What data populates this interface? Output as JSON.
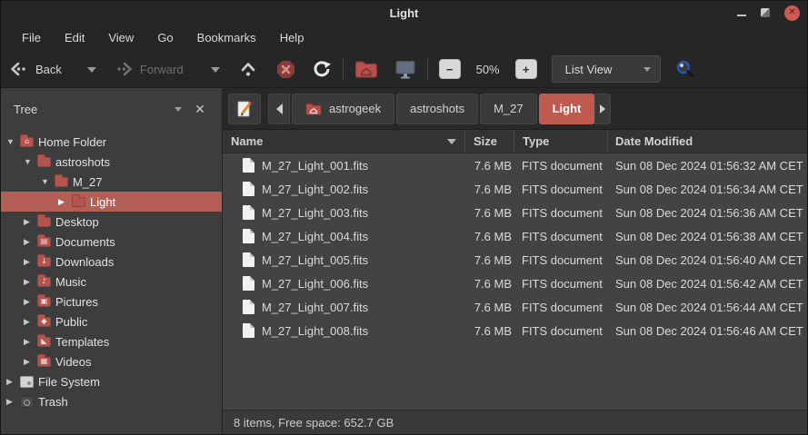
{
  "window": {
    "title": "Light"
  },
  "menubar": {
    "items": [
      "File",
      "Edit",
      "View",
      "Go",
      "Bookmarks",
      "Help"
    ]
  },
  "toolbar": {
    "back_label": "Back",
    "forward_label": "Forward",
    "zoom_level": "50%",
    "view_mode": "List View"
  },
  "sidebar": {
    "header_title": "Tree",
    "items": [
      {
        "label": "Home Folder",
        "icon": "home-folder-icon",
        "glyph": "⌂"
      },
      {
        "label": "astroshots",
        "icon": "folder-icon",
        "glyph": ""
      },
      {
        "label": "M_27",
        "icon": "folder-icon",
        "glyph": ""
      },
      {
        "label": "Light",
        "icon": "folder-icon",
        "glyph": ""
      },
      {
        "label": "Desktop",
        "icon": "desktop-folder-icon",
        "glyph": ""
      },
      {
        "label": "Documents",
        "icon": "documents-folder-icon",
        "glyph": "▤"
      },
      {
        "label": "Downloads",
        "icon": "downloads-folder-icon",
        "glyph": "↓"
      },
      {
        "label": "Music",
        "icon": "music-folder-icon",
        "glyph": "♪"
      },
      {
        "label": "Pictures",
        "icon": "pictures-folder-icon",
        "glyph": "▣"
      },
      {
        "label": "Public",
        "icon": "public-folder-icon",
        "glyph": "◆"
      },
      {
        "label": "Templates",
        "icon": "templates-folder-icon",
        "glyph": "◣"
      },
      {
        "label": "Videos",
        "icon": "videos-folder-icon",
        "glyph": "▦"
      },
      {
        "label": "File System",
        "icon": "drive-icon",
        "glyph": ""
      },
      {
        "label": "Trash",
        "icon": "trash-icon",
        "glyph": ""
      }
    ]
  },
  "pathbar": {
    "crumbs": [
      {
        "label": "astrogeek"
      },
      {
        "label": "astroshots"
      },
      {
        "label": "M_27"
      },
      {
        "label": "Light"
      }
    ]
  },
  "filelist": {
    "columns": {
      "name": "Name",
      "size": "Size",
      "type": "Type",
      "modified": "Date Modified"
    },
    "rows": [
      {
        "name": "M_27_Light_001.fits",
        "size": "7.6 MB",
        "type": "FITS document",
        "modified": "Sun 08 Dec 2024 01:56:32 AM CET"
      },
      {
        "name": "M_27_Light_002.fits",
        "size": "7.6 MB",
        "type": "FITS document",
        "modified": "Sun 08 Dec 2024 01:56:34 AM CET"
      },
      {
        "name": "M_27_Light_003.fits",
        "size": "7.6 MB",
        "type": "FITS document",
        "modified": "Sun 08 Dec 2024 01:56:36 AM CET"
      },
      {
        "name": "M_27_Light_004.fits",
        "size": "7.6 MB",
        "type": "FITS document",
        "modified": "Sun 08 Dec 2024 01:56:38 AM CET"
      },
      {
        "name": "M_27_Light_005.fits",
        "size": "7.6 MB",
        "type": "FITS document",
        "modified": "Sun 08 Dec 2024 01:56:40 AM CET"
      },
      {
        "name": "M_27_Light_006.fits",
        "size": "7.6 MB",
        "type": "FITS document",
        "modified": "Sun 08 Dec 2024 01:56:42 AM CET"
      },
      {
        "name": "M_27_Light_007.fits",
        "size": "7.6 MB",
        "type": "FITS document",
        "modified": "Sun 08 Dec 2024 01:56:44 AM CET"
      },
      {
        "name": "M_27_Light_008.fits",
        "size": "7.6 MB",
        "type": "FITS document",
        "modified": "Sun 08 Dec 2024 01:56:46 AM CET"
      }
    ]
  },
  "statusbar": {
    "text": "8 items, Free space: 652.7 GB"
  },
  "colors": {
    "accent_red": "#b4544e",
    "selection": "#b45f56",
    "crumb_active": "#bf5a51",
    "top_bg": "#262626",
    "sidebar_bg": "#3d3d3d",
    "list_bg": "#434343",
    "close_button": "#ca5a52"
  }
}
